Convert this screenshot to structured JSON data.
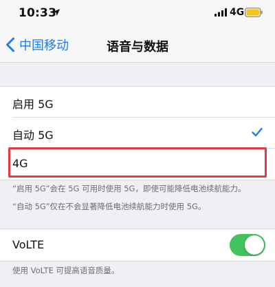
{
  "status_bar": {
    "time": "10:33",
    "network": "4G",
    "icons": [
      "location-arrow-icon",
      "cell-signal-icon",
      "battery-icon"
    ],
    "battery_color": "#f5c518"
  },
  "nav": {
    "back_label": "中国移动",
    "title": "语音与数据"
  },
  "options": [
    {
      "label": "启用 5G",
      "selected": false
    },
    {
      "label": "自动 5G",
      "selected": true
    },
    {
      "label": "4G",
      "selected": false,
      "highlighted": true
    }
  ],
  "footnotes": [
    "“启用 5G”会在 5G 可用时使用 5G，即使可能降低电池续航能力。",
    "“自动 5G”仅在不会显著降低电池续航能力时使用 5G。"
  ],
  "volte": {
    "label": "VoLTE",
    "enabled": true,
    "footer": "使用 VoLTE 可提高语音质量。"
  },
  "colors": {
    "accent": "#1a7cf5",
    "toggle_on": "#43c35e",
    "highlight": "#e23b3f"
  }
}
